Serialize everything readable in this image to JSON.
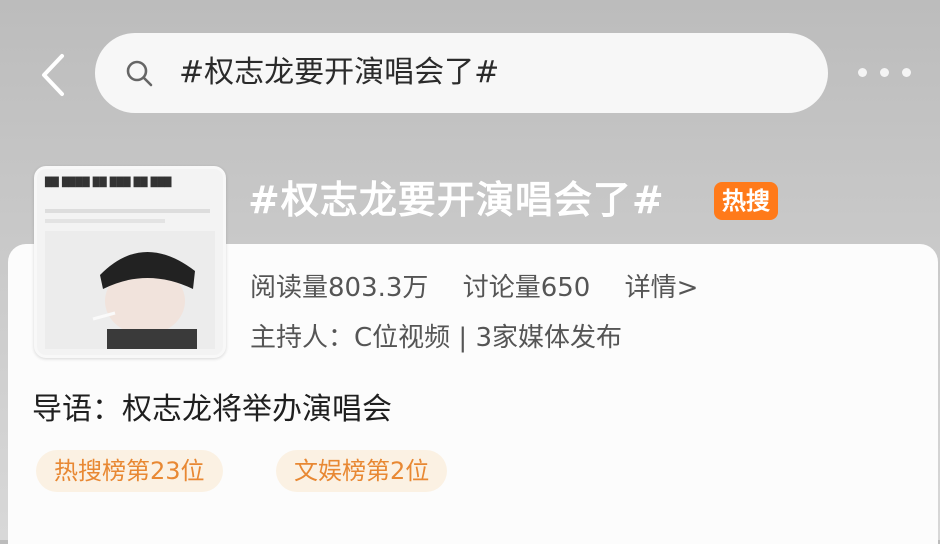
{
  "header": {
    "search_text": "#权志龙要开演唱会了#",
    "icons": {
      "back": "chevron-left-icon",
      "search": "search-icon",
      "more": "more-horizontal-icon"
    }
  },
  "topic": {
    "title": "#权志龙要开演唱会了#",
    "badge": "热搜",
    "reads": "阅读量803.3万",
    "discussions": "讨论量650",
    "details": "详情>",
    "host": "主持人：C位视频 | 3家媒体发布",
    "intro": "导语：权志龙将举办演唱会",
    "tags": [
      "热搜榜第23位",
      "文娱榜第2位"
    ]
  },
  "thumbnail": {
    "caption": "(Korean headline text)"
  },
  "colors": {
    "hot_badge": "#ff7a1a",
    "tag_text": "#e88833",
    "tag_bg": "#fbf1e3"
  }
}
